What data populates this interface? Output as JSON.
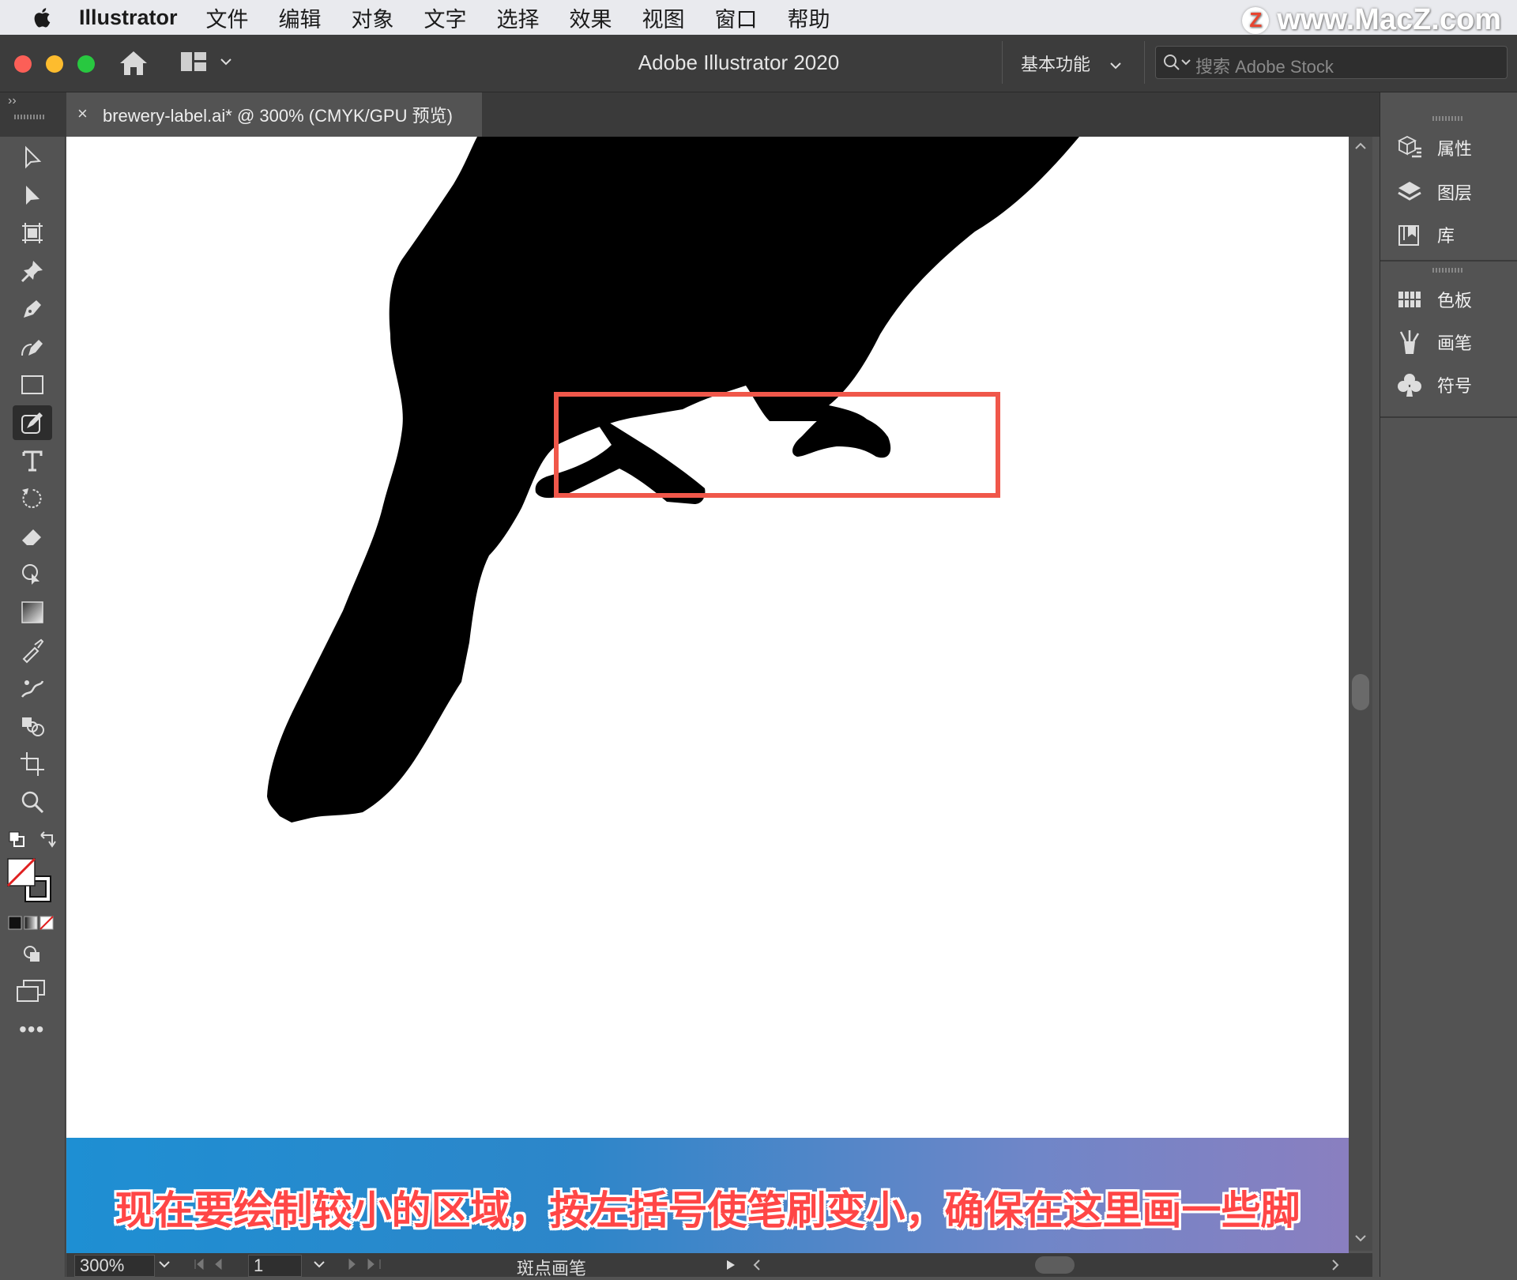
{
  "menubar": {
    "app_name": "Illustrator",
    "items": [
      "文件",
      "编辑",
      "对象",
      "文字",
      "选择",
      "效果",
      "视图",
      "窗口",
      "帮助"
    ],
    "watermark": "www.MacZ.com",
    "watermark_badge": "Z"
  },
  "titlebar": {
    "title": "Adobe Illustrator 2020",
    "workspace": "基本功能",
    "search_placeholder": "搜索 Adobe Stock"
  },
  "document_tab": {
    "close": "×",
    "title": "brewery-label.ai* @ 300% (CMYK/GPU 预览)"
  },
  "tools": [
    "selection-tool",
    "direct-selection-tool",
    "artboard-tool",
    "puppet-warp-tool",
    "pen-tool",
    "curvature-tool",
    "rectangle-tool",
    "blob-brush-tool",
    "type-tool",
    "rotate-tool",
    "eraser-tool",
    "shape-builder-tool",
    "gradient-tool",
    "eyedropper-tool",
    "symbol-sprayer-tool",
    "blend-tool",
    "crop-tool",
    "zoom-tool"
  ],
  "right_panel": {
    "group1": [
      {
        "label": "属性",
        "icon": "properties-icon"
      },
      {
        "label": "图层",
        "icon": "layers-icon"
      },
      {
        "label": "库",
        "icon": "libraries-icon"
      }
    ],
    "group2": [
      {
        "label": "色板",
        "icon": "swatches-icon"
      },
      {
        "label": "画笔",
        "icon": "brushes-icon"
      },
      {
        "label": "符号",
        "icon": "symbols-icon"
      }
    ]
  },
  "subtitle": "现在要绘制较小的区域，按左括号使笔刷变小，确保在这里画一些脚",
  "statusbar": {
    "zoom": "300%",
    "page": "1",
    "brush_name": "斑点画笔"
  },
  "colors": {
    "highlight_box": "#f0574a",
    "subtitle_text": "#ff4646"
  }
}
